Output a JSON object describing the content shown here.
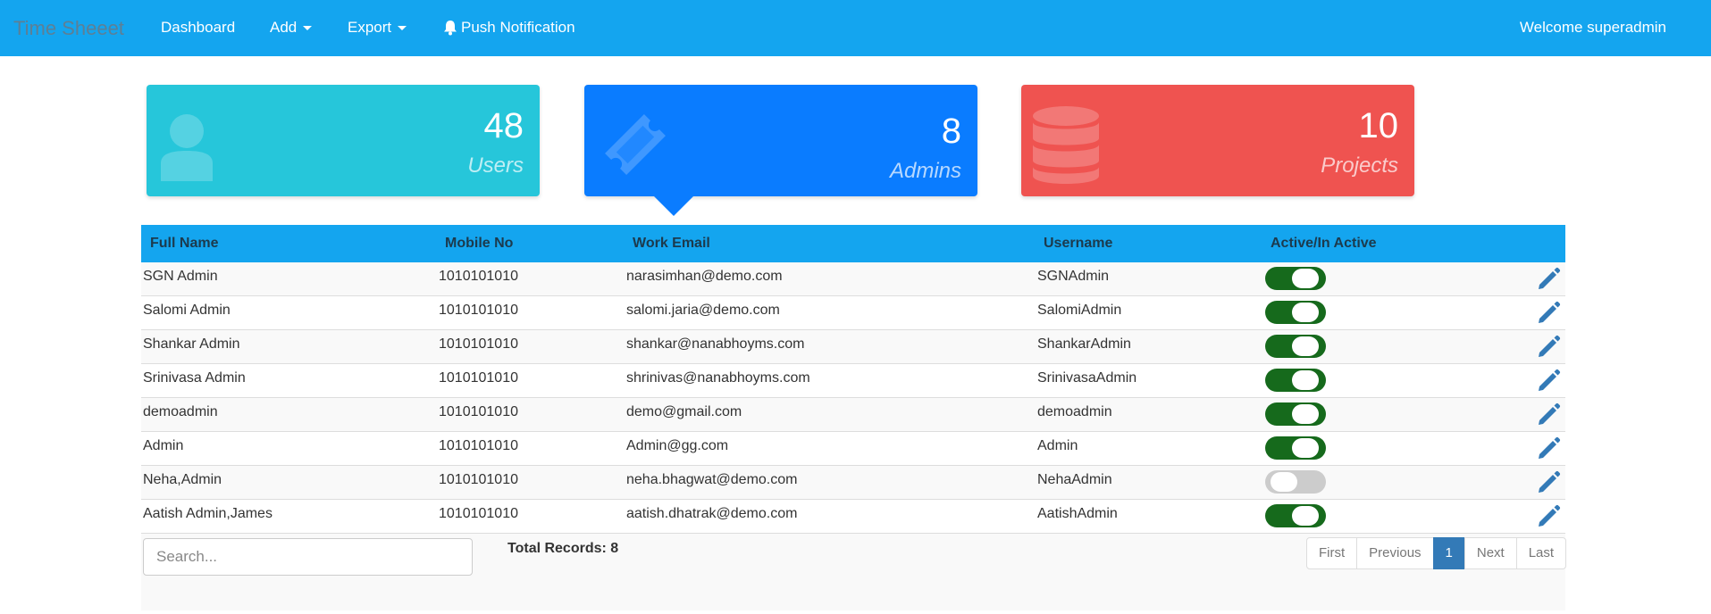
{
  "navbar": {
    "brand": "Time Sheeet",
    "dashboard": "Dashboard",
    "add": "Add",
    "export": "Export",
    "push": "Push Notification",
    "welcome": "Welcome superadmin"
  },
  "cards": {
    "users": {
      "count": "48",
      "label": "Users"
    },
    "admins": {
      "count": "8",
      "label": "Admins"
    },
    "projects": {
      "count": "10",
      "label": "Projects"
    }
  },
  "table": {
    "headers": {
      "full_name": "Full Name",
      "mobile": "Mobile No",
      "email": "Work Email",
      "username": "Username",
      "active": "Active/In Active"
    },
    "rows": [
      {
        "name": "SGN Admin",
        "mobile": "1010101010",
        "email": "narasimhan@demo.com",
        "username": "SGNAdmin",
        "active": true
      },
      {
        "name": "Salomi Admin",
        "mobile": "1010101010",
        "email": "salomi.jaria@demo.com",
        "username": "SalomiAdmin",
        "active": true
      },
      {
        "name": "Shankar Admin",
        "mobile": "1010101010",
        "email": "shankar@nanabhoyms.com",
        "username": "ShankarAdmin",
        "active": true
      },
      {
        "name": "Srinivasa Admin",
        "mobile": "1010101010",
        "email": "shrinivas@nanabhoyms.com",
        "username": "SrinivasaAdmin",
        "active": true
      },
      {
        "name": "demoadmin",
        "mobile": "1010101010",
        "email": "demo@gmail.com",
        "username": "demoadmin",
        "active": true
      },
      {
        "name": "Admin",
        "mobile": "1010101010",
        "email": "Admin@gg.com",
        "username": "Admin",
        "active": true
      },
      {
        "name": "Neha,Admin",
        "mobile": "1010101010",
        "email": "neha.bhagwat@demo.com",
        "username": "NehaAdmin",
        "active": false
      },
      {
        "name": "Aatish Admin,James",
        "mobile": "1010101010",
        "email": "aatish.dhatrak@demo.com",
        "username": "AatishAdmin",
        "active": true
      }
    ]
  },
  "footer": {
    "search_placeholder": "Search...",
    "total_records": "Total Records: 8",
    "pagination": [
      "First",
      "Previous",
      "1",
      "Next",
      "Last"
    ],
    "active_page": "1"
  },
  "colors": {
    "navbar": "#14a5ef",
    "users_card": "#26c6da",
    "admins_card": "#0a7cff",
    "projects_card": "#ef5350",
    "toggle_on": "#166a1c",
    "edit_icon": "#337ab7"
  }
}
